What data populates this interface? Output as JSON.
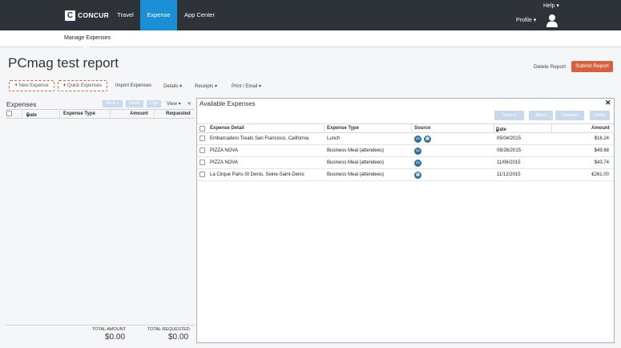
{
  "nav": {
    "logo_letter": "C",
    "logo_text": "CONCUR",
    "items": [
      "Travel",
      "Expense",
      "App Center"
    ],
    "help": "Help",
    "profile": "Profile",
    "active_color": "#1b8fd6"
  },
  "subnav": {
    "item": "Manage Expenses"
  },
  "report": {
    "title": "PCmag test report",
    "delete_label": "Delete Report",
    "submit_label": "Submit Report"
  },
  "toolbar": {
    "new_expense": "New Expense",
    "quick_expenses": "Quick Expenses",
    "import_expenses": "Import Expenses",
    "details": "Details",
    "receipts": "Receipts",
    "print_email": "Print / Email"
  },
  "left_panel": {
    "title": "Expenses",
    "move": "Move",
    "delete": "Delete",
    "copy": "Copy",
    "view": "View",
    "collapse": "«",
    "columns": [
      "Date",
      "Expense Type",
      "Amount",
      "Requested"
    ],
    "total_amount_label": "TOTAL AMOUNT",
    "total_amount": "$0.00",
    "total_requested_label": "TOTAL REQUESTED",
    "total_requested": "$0.00"
  },
  "right_panel": {
    "title": "Available Expenses",
    "close": "✕",
    "move": "Move",
    "attach": "Attach",
    "unattach": "Unattach",
    "delete": "Delete",
    "columns": [
      "Expense Detail",
      "Expense Type",
      "Source",
      "Date",
      "Amount"
    ],
    "rows": [
      {
        "detail": "Embarcadero Treats San Francisco, California",
        "type": "Lunch",
        "date": "05/04/2015",
        "amount": "$16.24",
        "sources": [
          "card",
          "receipt"
        ]
      },
      {
        "detail": "PIZZA NOVA",
        "type": "Business Meal (attendees)",
        "date": "08/26/2015",
        "amount": "$49.68",
        "sources": [
          "card"
        ]
      },
      {
        "detail": "PIZZA NOVA",
        "type": "Business Meal (attendees)",
        "date": "11/06/2015",
        "amount": "$43.74",
        "sources": [
          "card"
        ]
      },
      {
        "detail": "La Cirque Paris-St Denis, Seine-Saint-Denis",
        "type": "Business Meal (attendees)",
        "date": "11/12/2015",
        "amount": "€261.00",
        "sources": [
          "receipt"
        ]
      }
    ]
  }
}
